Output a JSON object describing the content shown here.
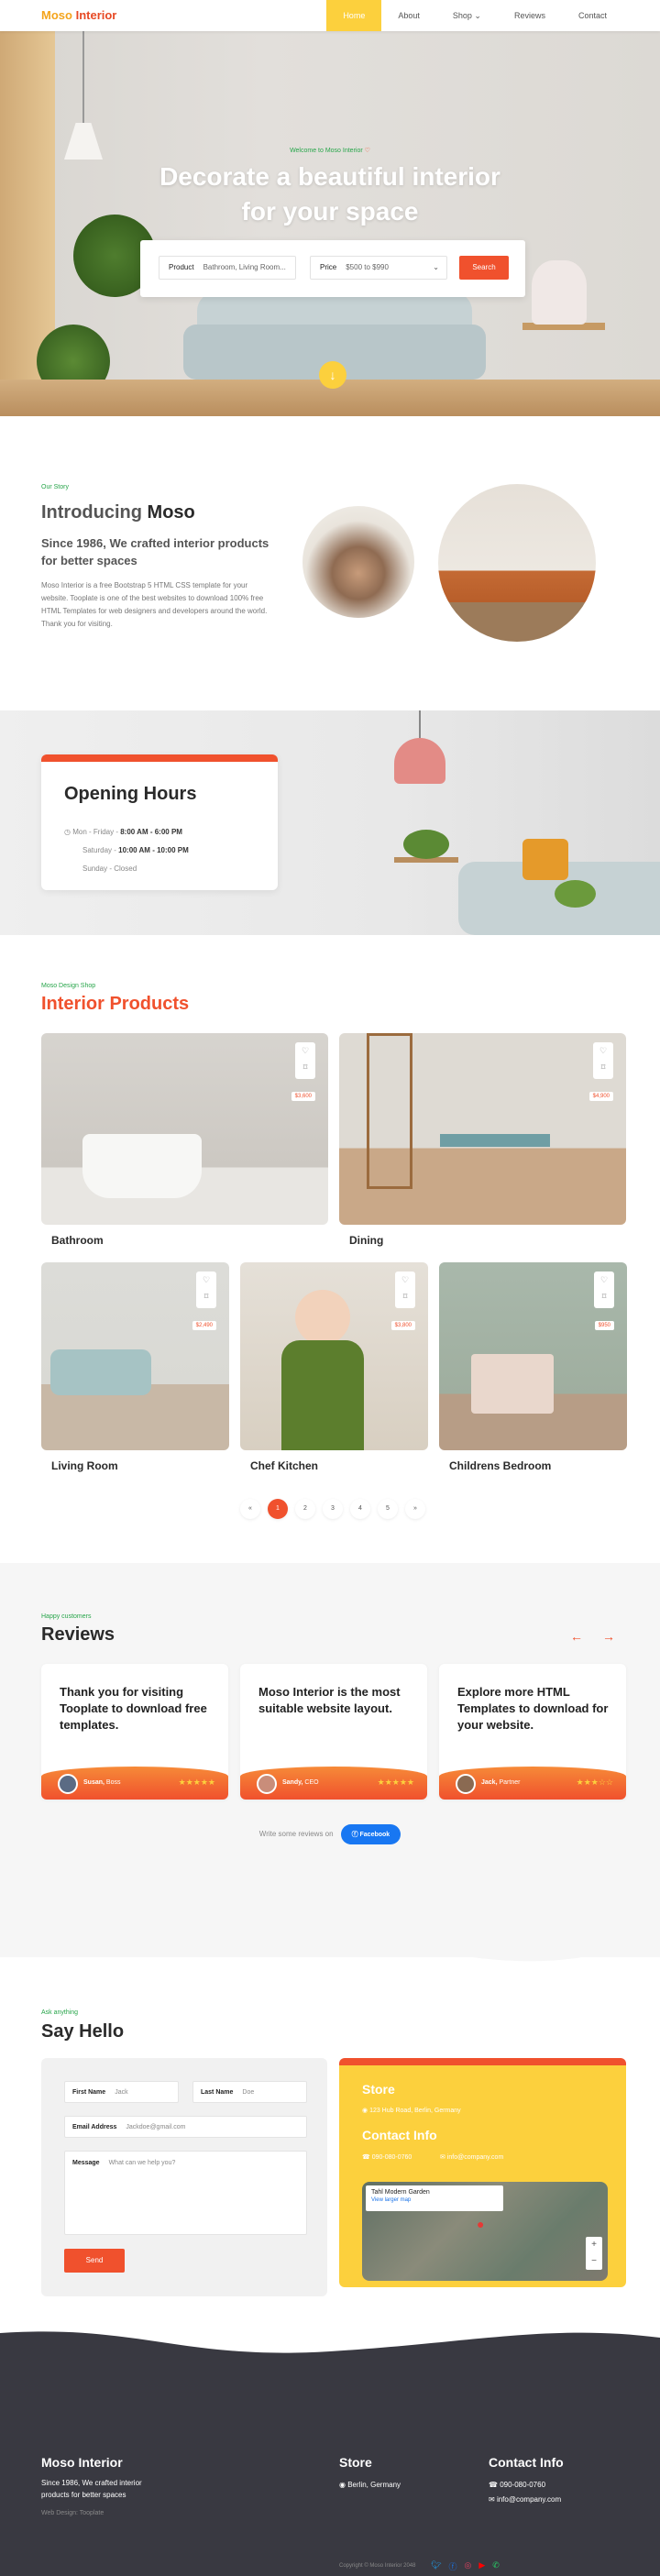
{
  "brand": {
    "word1": "Moso",
    "word2": "Interior"
  },
  "nav": [
    "Home",
    "About",
    "Shop",
    "Reviews",
    "Contact"
  ],
  "nav_shop_caret": "⌄",
  "hero": {
    "welcome": "Welcome to Moso Interior",
    "title1": "Decorate a beautiful interior",
    "title2": "for your space",
    "product_label": "Product",
    "product_value": "Bathroom, Living Room...",
    "price_label": "Price",
    "price_value": "$500 to $990",
    "search_button": "Search"
  },
  "story": {
    "label": "Our Story",
    "title_light": "Introducing",
    "title_bold": "Moso",
    "subtitle": "Since 1986, We crafted interior products for better spaces",
    "body": "Moso Interior is a free Bootstrap 5 HTML CSS template for your website. Tooplate is one of the best websites to download 100% free HTML Templates for web designers and developers around the world. Thank you for visiting."
  },
  "hours": {
    "title": "Opening Hours",
    "r1_day": "Mon - Friday - ",
    "r1_time": "8:00 AM - 6:00 PM",
    "r2_day": "Saturday - ",
    "r2_time": "10:00 AM - 10:00 PM",
    "r3": "Sunday - Closed"
  },
  "shop": {
    "label": "Moso Design Shop",
    "title_accent": "Interior",
    "title_rest": "Products",
    "products": [
      {
        "name": "Bathroom",
        "price": "$3,600"
      },
      {
        "name": "Dining",
        "price": "$4,900"
      },
      {
        "name": "Living Room",
        "price": "$2,490"
      },
      {
        "name": "Chef Kitchen",
        "price": "$3,800"
      },
      {
        "name": "Childrens Bedroom",
        "price": "$950"
      }
    ],
    "pages": [
      "«",
      "1",
      "2",
      "3",
      "4",
      "5",
      "»"
    ]
  },
  "reviews": {
    "label": "Happy customers",
    "title": "Reviews",
    "items": [
      {
        "text": "Thank you for visiting Tooplate to download free templates.",
        "name": "Susan,",
        "role": "Boss",
        "stars": "★★★★★"
      },
      {
        "text": "Moso Interior is the most suitable website layout.",
        "name": "Sandy,",
        "role": "CEO",
        "stars": "★★★★★"
      },
      {
        "text": "Explore more HTML Templates to download for your website.",
        "name": "Jack,",
        "role": "Partner",
        "stars": "★★★☆☆"
      }
    ],
    "fb_text": "Write some reviews on",
    "fb_button": "Facebook"
  },
  "hello": {
    "label": "Ask anything",
    "title": "Say Hello",
    "first_label": "First Name",
    "first_ph": "Jack",
    "last_label": "Last Name",
    "last_ph": "Doe",
    "email_label": "Email Address",
    "email_ph": "Jackdoe@gmail.com",
    "msg_label": "Message",
    "msg_ph": "What can we help you?",
    "send": "Send"
  },
  "store": {
    "title": "Store",
    "address": "123 Hub Road, Berlin, Germany",
    "contact_title": "Contact Info",
    "phone": "090-080-0760",
    "email": "info@company.com",
    "map_place": "Tahl Modern Garden",
    "map_link": "View larger map"
  },
  "footer": {
    "brand": "Moso Interior",
    "tagline": "Since 1986, We crafted interior products for better spaces",
    "design": "Web Design: Tooplate",
    "store_title": "Store",
    "store_addr": "Berlin, Germany",
    "contact_title": "Contact Info",
    "phone": "090-080-0760",
    "email": "info@company.com",
    "copyright": "Copyright © Moso Interior 2048"
  },
  "colors": {
    "accent": "#f0512d",
    "yellow": "#fcd03d",
    "green": "#27a54a",
    "dark": "#393941"
  }
}
